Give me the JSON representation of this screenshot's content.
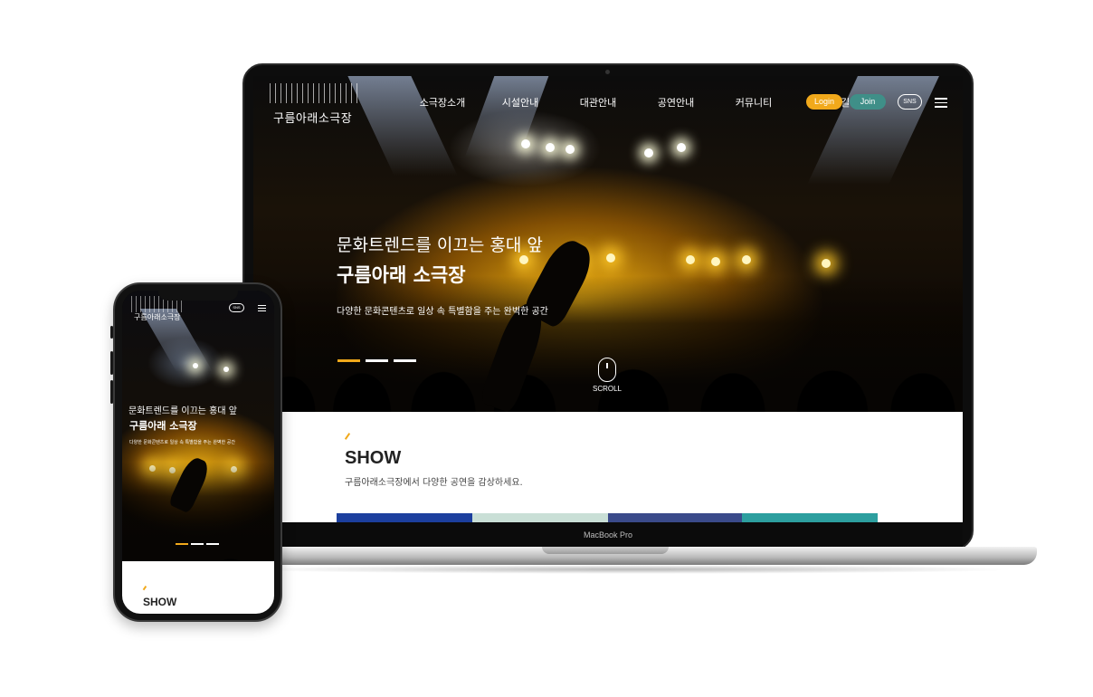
{
  "laptop": {
    "brand": "MacBook Pro"
  },
  "site": {
    "logo": "구름아래소극장",
    "nav": [
      "소극장소개",
      "시설안내",
      "대관안내",
      "공연안내",
      "커뮤니티",
      "오시는길"
    ],
    "login_label": "Login",
    "join_label": "Join",
    "sns_label": "SNS",
    "hero": {
      "subtitle": "문화트렌드를 이끄는 홍대 앞",
      "title": "구름아래 소극장",
      "description": "다양한 문화콘텐츠로 일상 속 특별함을 주는 완벽한 공간",
      "slides": 3,
      "active_slide": 1,
      "scroll_label": "SCROLL"
    },
    "show": {
      "title": "SHOW",
      "description": "구름아래소극장에서 다양한 공연을 감상하세요."
    }
  },
  "colors": {
    "accent": "#f1a91b",
    "join": "#3f8f88",
    "thumb_1": "#1c3f9e",
    "thumb_2": "#c9dfd6",
    "thumb_3": "#3a4a8a",
    "thumb_4": "#2d9f9f"
  },
  "icons": [
    "hamburger-icon",
    "mouse-scroll-icon"
  ]
}
